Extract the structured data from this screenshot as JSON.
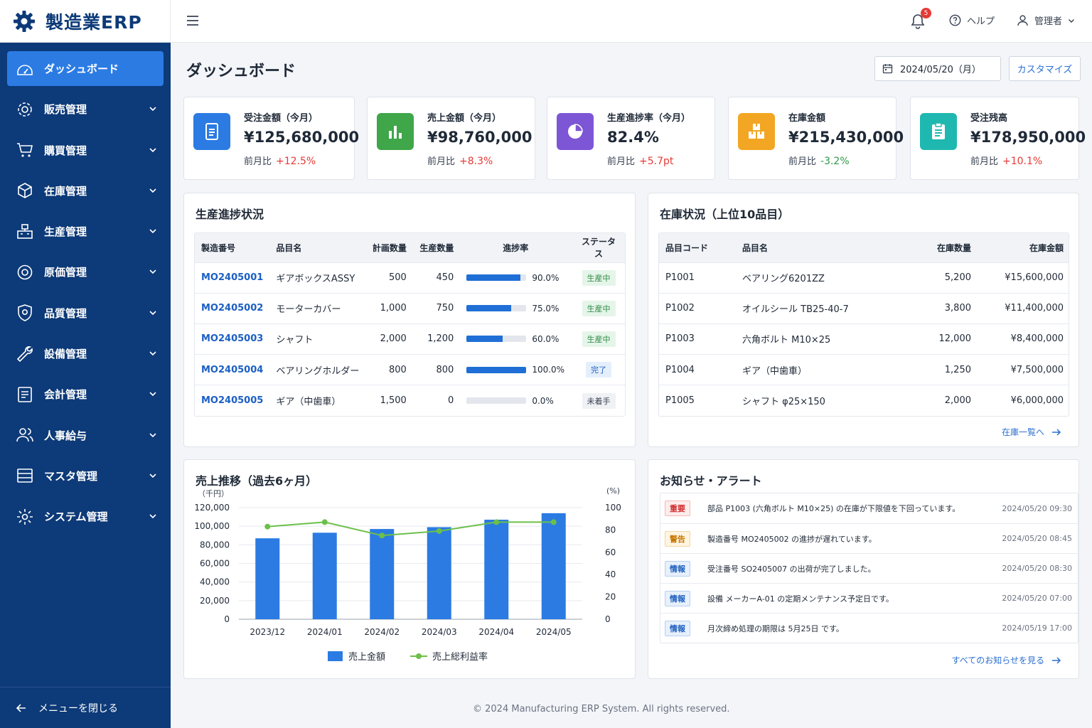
{
  "app": {
    "brand": "製造業ERP"
  },
  "sidebar": {
    "items": [
      {
        "label": "ダッシュボード",
        "icon": "dashboard-icon",
        "active": true,
        "expandable": false
      },
      {
        "label": "販売管理",
        "icon": "sales-gear-icon",
        "expandable": true
      },
      {
        "label": "購買管理",
        "icon": "cart-icon",
        "expandable": true
      },
      {
        "label": "在庫管理",
        "icon": "box-icon",
        "expandable": true
      },
      {
        "label": "生産管理",
        "icon": "factory-icon",
        "expandable": true
      },
      {
        "label": "原価管理",
        "icon": "cost-icon",
        "expandable": true
      },
      {
        "label": "品質管理",
        "icon": "shield-icon",
        "expandable": true
      },
      {
        "label": "設備管理",
        "icon": "wrench-icon",
        "expandable": true
      },
      {
        "label": "会計管理",
        "icon": "ledger-icon",
        "expandable": true
      },
      {
        "label": "人事給与",
        "icon": "users-icon",
        "expandable": true
      },
      {
        "label": "マスタ管理",
        "icon": "list-icon",
        "expandable": true
      },
      {
        "label": "システム管理",
        "icon": "settings-icon",
        "expandable": true
      }
    ],
    "collapse_label": "メニューを閉じる"
  },
  "topbar": {
    "notification_count": "5",
    "help_label": "ヘルプ",
    "user_label": "管理者"
  },
  "page": {
    "title": "ダッシュボード",
    "date_label": "2024/05/20（月）",
    "customize_label": "カスタマイズ"
  },
  "kpis": [
    {
      "label": "受注金額（今月）",
      "value": "¥125,680,000",
      "cmp_label": "前月比",
      "cmp_value": "+12.5%",
      "trend": "up",
      "color": "#2b7be3",
      "icon": "document-icon"
    },
    {
      "label": "売上金額（今月）",
      "value": "¥98,760,000",
      "cmp_label": "前月比",
      "cmp_value": "+8.3%",
      "trend": "up",
      "color": "#3fa64a",
      "icon": "bar-chart-icon"
    },
    {
      "label": "生産進捗率（今月）",
      "value": "82.4%",
      "cmp_label": "前月比",
      "cmp_value": "+5.7pt",
      "trend": "up",
      "color": "#7d56d6",
      "icon": "pie-chart-icon"
    },
    {
      "label": "在庫金額",
      "value": "¥215,430,000",
      "cmp_label": "前月比",
      "cmp_value": "-3.2%",
      "trend": "down",
      "color": "#f3a623",
      "icon": "boxes-icon"
    },
    {
      "label": "受注残高",
      "value": "¥178,950,000",
      "cmp_label": "前月比",
      "cmp_value": "+10.1%",
      "trend": "up",
      "color": "#1fb8b0",
      "icon": "clipboard-icon"
    }
  ],
  "production": {
    "title": "生産進捗状況",
    "headers": [
      "製造番号",
      "品目名",
      "計画数量",
      "生産数量",
      "進捗率",
      "ステータス"
    ],
    "rows": [
      {
        "no": "MO2405001",
        "item": "ギアボックスASSY",
        "plan": "500",
        "done": "450",
        "progress": 0.9,
        "pct": "90.0%",
        "status": "生産中",
        "status_kind": "prod"
      },
      {
        "no": "MO2405002",
        "item": "モーターカバー",
        "plan": "1,000",
        "done": "750",
        "progress": 0.75,
        "pct": "75.0%",
        "status": "生産中",
        "status_kind": "prod"
      },
      {
        "no": "MO2405003",
        "item": "シャフト",
        "plan": "2,000",
        "done": "1,200",
        "progress": 0.6,
        "pct": "60.0%",
        "status": "生産中",
        "status_kind": "prod"
      },
      {
        "no": "MO2405004",
        "item": "ベアリングホルダー",
        "plan": "800",
        "done": "800",
        "progress": 1.0,
        "pct": "100.0%",
        "status": "完了",
        "status_kind": "done"
      },
      {
        "no": "MO2405005",
        "item": "ギア（中歯車）",
        "plan": "1,500",
        "done": "0",
        "progress": 0.0,
        "pct": "0.0%",
        "status": "未着手",
        "status_kind": "none"
      }
    ]
  },
  "inventory": {
    "title": "在庫状況（上位10品目）",
    "headers": [
      "品目コード",
      "品目名",
      "在庫数量",
      "在庫金額"
    ],
    "rows": [
      {
        "code": "P1001",
        "name": "ベアリング6201ZZ",
        "qty": "5,200",
        "amount": "¥15,600,000"
      },
      {
        "code": "P1002",
        "name": "オイルシール TB25-40-7",
        "qty": "3,800",
        "amount": "¥11,400,000"
      },
      {
        "code": "P1003",
        "name": "六角ボルト M10×25",
        "qty": "12,000",
        "amount": "¥8,400,000"
      },
      {
        "code": "P1004",
        "name": "ギア（中歯車）",
        "qty": "1,250",
        "amount": "¥7,500,000"
      },
      {
        "code": "P1005",
        "name": "シャフト φ25×150",
        "qty": "2,000",
        "amount": "¥6,000,000"
      }
    ],
    "more_label": "在庫一覧へ"
  },
  "sales_chart": {
    "title": "売上推移（過去6ヶ月）",
    "left_unit": "（千円）",
    "right_unit": "(%)"
  },
  "chart_data": {
    "type": "bar",
    "categories": [
      "2023/12",
      "2024/01",
      "2024/02",
      "2024/03",
      "2024/04",
      "2024/05"
    ],
    "series": [
      {
        "name": "売上金額",
        "type": "bar",
        "axis": "left",
        "color": "#2b7be3",
        "values": [
          87000,
          93000,
          97000,
          99000,
          107000,
          114000
        ]
      },
      {
        "name": "売上総利益率",
        "type": "line",
        "axis": "right",
        "color": "#6cc04a",
        "values": [
          83,
          87,
          75,
          79,
          87,
          87
        ]
      }
    ],
    "y_left": {
      "min": 0,
      "max": 120000,
      "ticks": [
        "120,000",
        "100,000",
        "80,000",
        "60,000",
        "40,000",
        "20,000",
        "0"
      ]
    },
    "y_right": {
      "min": 0,
      "max": 100,
      "ticks": [
        "100",
        "80",
        "60",
        "40",
        "20",
        "0"
      ]
    },
    "grid": true,
    "legend_position": "bottom"
  },
  "alerts": {
    "title": "お知らせ・アラート",
    "items": [
      {
        "tag": "重要",
        "kind": "crit",
        "message": "部品 P1003 (六角ボルト M10×25) の在庫が下限値を下回っています。",
        "time": "2024/05/20 09:30"
      },
      {
        "tag": "警告",
        "kind": "warn",
        "message": "製造番号 MO2405002 の進捗が遅れています。",
        "time": "2024/05/20 08:45"
      },
      {
        "tag": "情報",
        "kind": "info",
        "message": "受注番号 SO2405007 の出荷が完了しました。",
        "time": "2024/05/20 08:30"
      },
      {
        "tag": "情報",
        "kind": "info",
        "message": "設備 メーカーA-01 の定期メンテナンス予定日です。",
        "time": "2024/05/20 07:00"
      },
      {
        "tag": "情報",
        "kind": "info",
        "message": "月次締め処理の期限は 5月25日 です。",
        "time": "2024/05/19 17:00"
      }
    ],
    "more_label": "すべてのお知らせを見る"
  },
  "footer": {
    "text": "© 2024 Manufacturing ERP System. All rights reserved."
  }
}
